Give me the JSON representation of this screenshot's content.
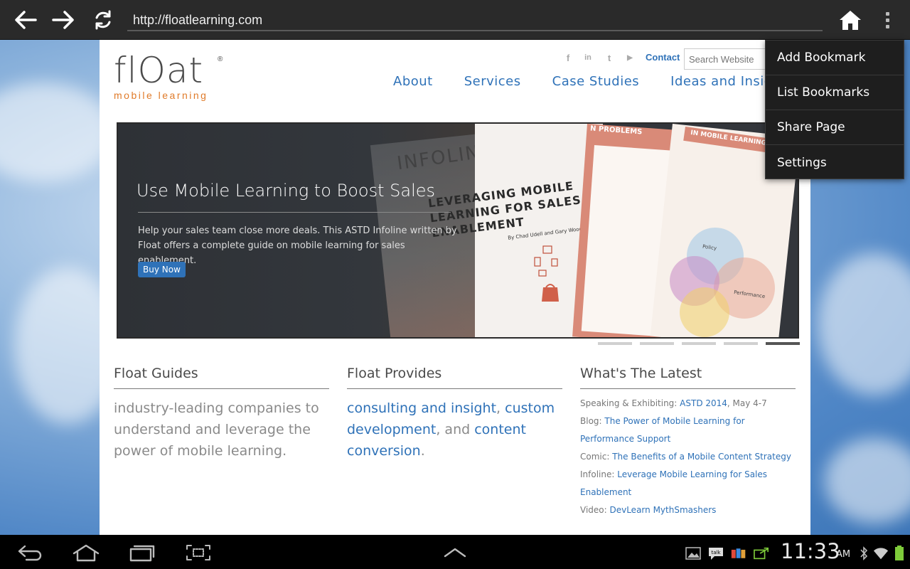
{
  "browser": {
    "url": "http://floatlearning.com",
    "icons": [
      "back-arrow-icon",
      "forward-arrow-icon",
      "refresh-icon",
      "home-icon",
      "overflow-menu-icon"
    ]
  },
  "menu": {
    "items": [
      "Add Bookmark",
      "List Bookmarks",
      "Share Page",
      "Settings"
    ]
  },
  "site": {
    "logo": {
      "main": "flOat",
      "sub": "mobile learning",
      "reg": "®"
    },
    "social": [
      {
        "name": "facebook-icon",
        "glyph": "f"
      },
      {
        "name": "linkedin-icon",
        "glyph": "in"
      },
      {
        "name": "twitter-icon",
        "glyph": "t"
      },
      {
        "name": "youtube-icon",
        "glyph": "▶"
      }
    ],
    "contact": "Contact",
    "search_placeholder": "Search Website",
    "nav": [
      "About",
      "Services",
      "Case Studies",
      "Ideas and Insights"
    ]
  },
  "hero": {
    "title": "Use Mobile Learning to Boost Sales",
    "description": "Help your sales team close more deals. This ASTD Infoline written by Float offers a complete guide on mobile learning for sales enablement.",
    "button": "Buy Now",
    "book_brand": "INFOLINE",
    "book_title": "LEVERAGING MOBILE LEARNING FOR SALES ENABLEMENT",
    "book_author": "By Chad Udell and Gary Woodill",
    "page2_heading": "N PROBLEMS",
    "page3_heading": "IN MOBILE LEARNING",
    "venn_labels": [
      "Policy",
      "Performance"
    ],
    "slider_active_index": 4,
    "slider_count": 5
  },
  "guides": {
    "title": "Float Guides",
    "body": "industry-leading companies to understand and leverage the power of mobile learning."
  },
  "provides": {
    "title": "Float Provides",
    "link1": "consulting and insight",
    "sep1": ", ",
    "link2": "custom development",
    "sep2": ", and ",
    "link3": "content conversion",
    "end": "."
  },
  "latest": {
    "title": "What's The Latest",
    "items": [
      {
        "prefix": "Speaking & Exhibiting: ",
        "link": "ASTD 2014",
        "suffix": ", May 4-7"
      },
      {
        "prefix": "Blog: ",
        "link": "The Power of Mobile Learning for Performance Support",
        "suffix": ""
      },
      {
        "prefix": "Comic: ",
        "link": "The Benefits of a Mobile Content Strategy",
        "suffix": ""
      },
      {
        "prefix": "Infoline: ",
        "link": "Leverage Mobile Learning for Sales Enablement",
        "suffix": ""
      },
      {
        "prefix": "Video: ",
        "link": "DevLearn MythSmashers",
        "suffix": ""
      }
    ]
  },
  "system": {
    "time": "11:33",
    "ampm": "AM",
    "nav_icons": [
      "system-back-icon",
      "system-home-icon",
      "recent-apps-icon",
      "screenshot-icon",
      "expand-up-icon"
    ],
    "status_icons": [
      "gallery-notification-icon",
      "talk-notification-icon",
      "media-notification-icon",
      "sync-notification-icon",
      "bluetooth-icon",
      "wifi-icon",
      "battery-icon"
    ]
  }
}
